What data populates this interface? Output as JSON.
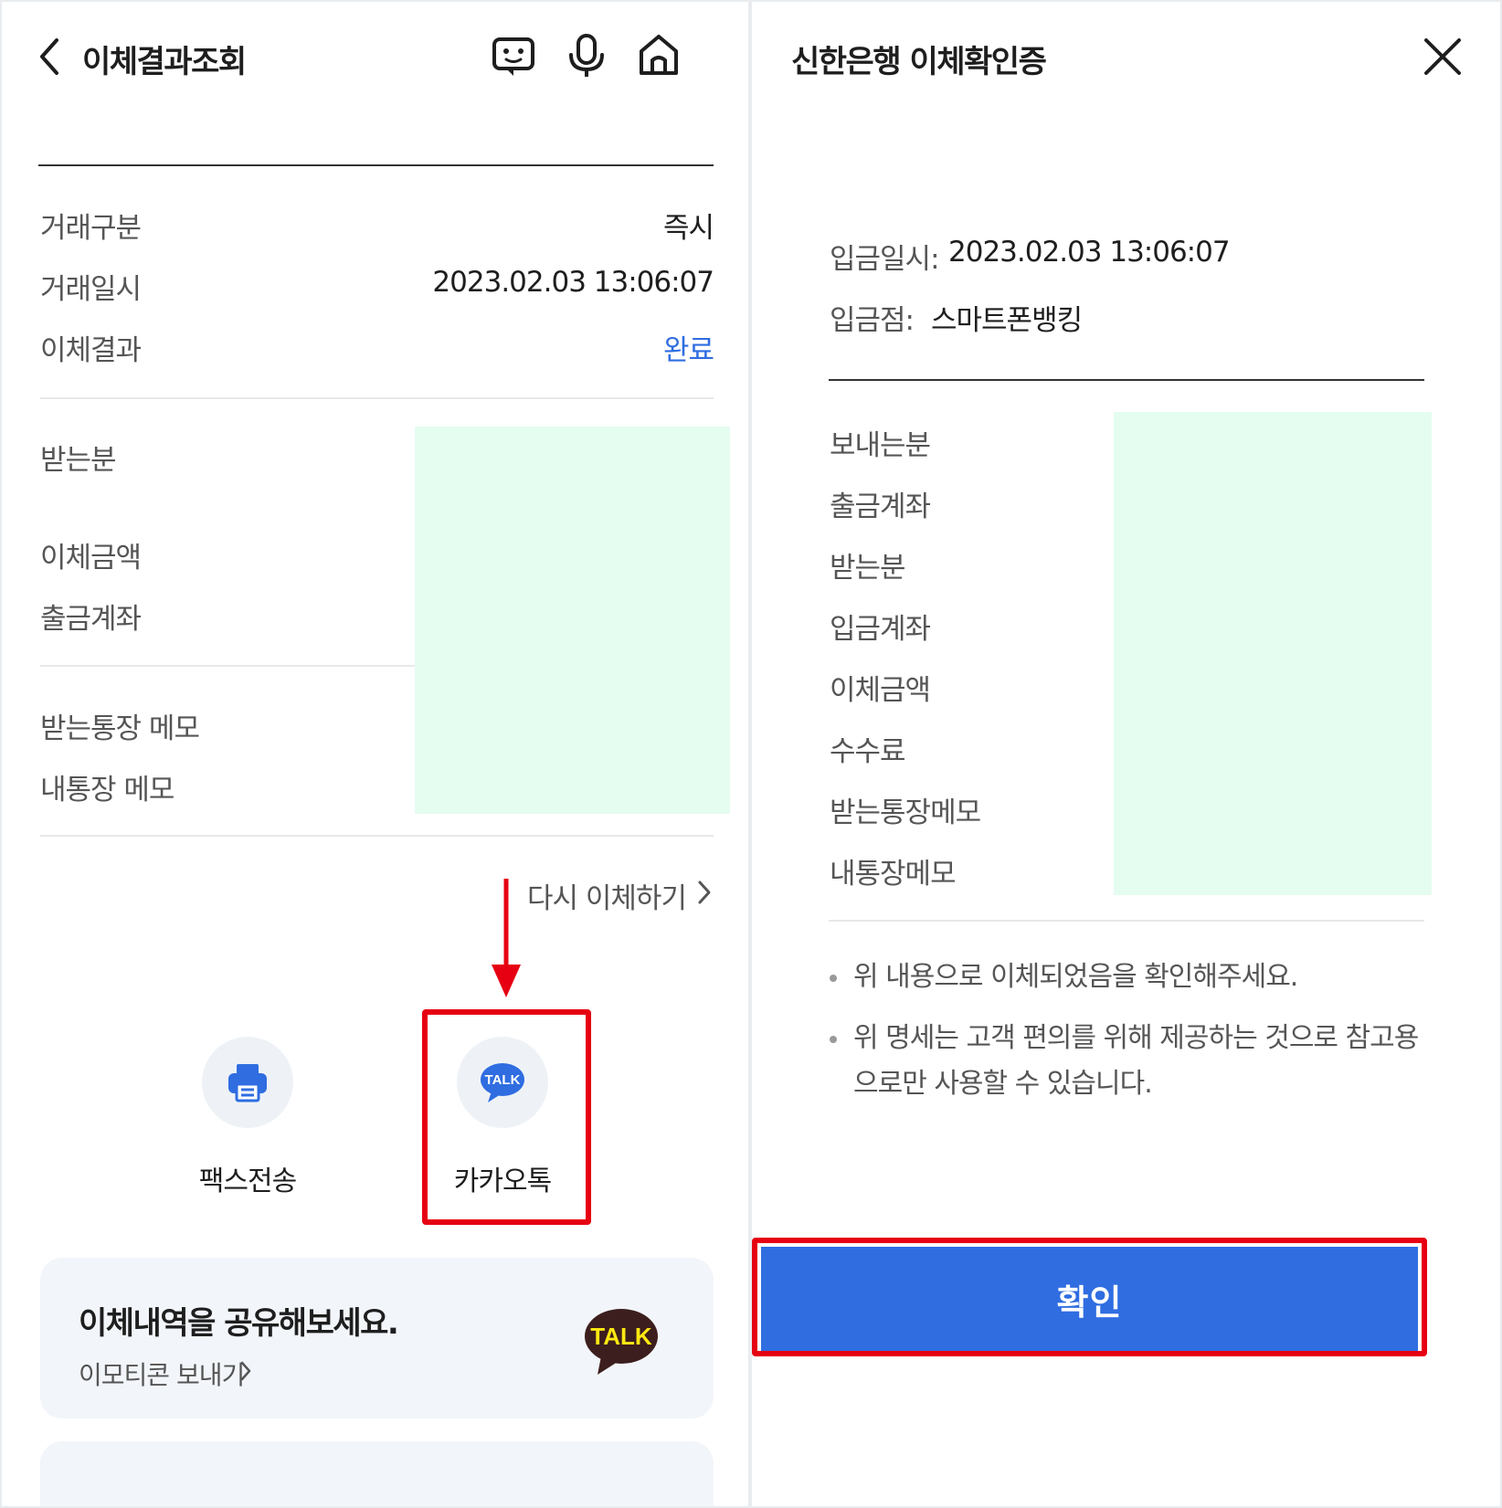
{
  "left": {
    "header": {
      "title": "이체결과조회",
      "back_icon": "chevron-left-icon",
      "chatbot_icon": "chatbot-icon",
      "mic_icon": "microphone-icon",
      "home_icon": "home-icon"
    },
    "details": [
      {
        "label": "거래구분",
        "value": "즉시"
      },
      {
        "label": "거래일시",
        "value": "2023.02.03 13:06:07"
      },
      {
        "label": "이체결과",
        "value": "완료"
      }
    ],
    "recipient": {
      "recipient_label": "받는분",
      "amount_label": "이체금액",
      "account_label": "출금계좌"
    },
    "memo": {
      "recipient_memo_label": "받는통장 메모",
      "my_memo_label": "내통장 메모"
    },
    "retry_link": "다시 이체하기",
    "share": {
      "fax_label": "팩스전송",
      "kakao_label": "카카오톡",
      "kakao_badge": "TALK"
    },
    "promo": {
      "title": "이체내역을 공유해보세요.",
      "link": "이모티콘 보내기",
      "badge": "TALK"
    },
    "status_color": "#2f6de1"
  },
  "right": {
    "header": {
      "title": "신한은행 이체확인증",
      "close_icon": "close-icon"
    },
    "deposit": {
      "date_label": "입금일시:",
      "date_value": "2023.02.03 13:06:07",
      "branch_label": "입금점:",
      "branch_value": "스마트폰뱅킹"
    },
    "fields": [
      "보내는분",
      "출금계좌",
      "받는분",
      "입금계좌",
      "이체금액",
      "수수료",
      "받는통장메모",
      "내통장메모"
    ],
    "notes": [
      "위 내용으로 이체되었음을 확인해주세요.",
      "위 명세는 고객 편의를 위해 제공하는 것으로 참고용으로만 사용할 수 있습니다."
    ],
    "confirm_button": "확인"
  },
  "colors": {
    "accent": "#2f6de1",
    "highlight": "#e60012",
    "redaction": "#e5fcf0",
    "kakao_yellow": "#ffe812",
    "kakao_brown": "#3c1e1e"
  }
}
